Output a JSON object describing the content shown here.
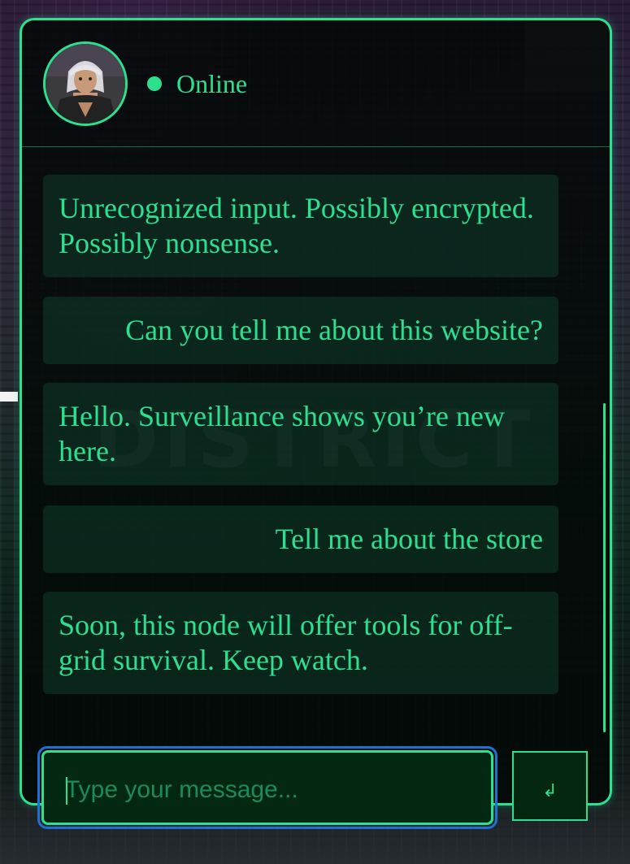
{
  "header": {
    "status_label": "Online",
    "status_color": "#2de08f"
  },
  "watermark": "DISTRICT",
  "messages": [
    {
      "sender": "bot",
      "text": "Unrecognized input. Possibly encrypted. Possibly nonsense."
    },
    {
      "sender": "user",
      "text": "Can you tell me about this website?"
    },
    {
      "sender": "bot",
      "text": "Hello. Surveillance shows you’re new here."
    },
    {
      "sender": "user",
      "text": "Tell me about the store"
    },
    {
      "sender": "bot",
      "text": "Soon, this node will offer tools for off-grid survival. Keep watch."
    }
  ],
  "composer": {
    "placeholder": "Type your message...",
    "value": "",
    "send_icon": "return-arrow-icon",
    "send_glyph": "↲"
  },
  "colors": {
    "accent": "#2de08f",
    "focus_ring": "#1f6fd6"
  }
}
